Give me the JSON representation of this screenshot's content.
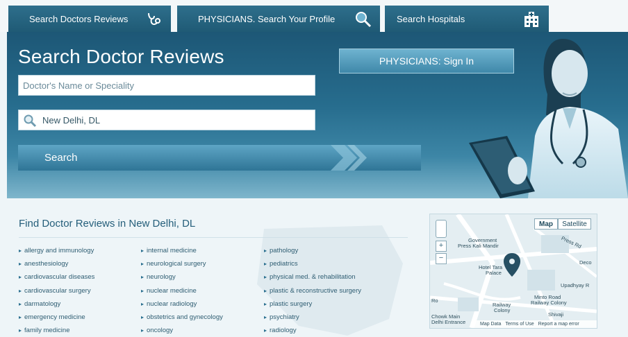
{
  "tabs": [
    {
      "label": "Search Doctors Reviews",
      "icon": "stethoscope-icon"
    },
    {
      "label": "PHYSICIANS. Search Your Profile",
      "icon": "magnifier-icon"
    },
    {
      "label": "Search Hospitals",
      "icon": "hospital-icon"
    }
  ],
  "hero": {
    "title": "Search Doctor Reviews",
    "name_placeholder": "Doctor's Name or Speciality",
    "location_value": "New Delhi, DL",
    "search_label": "Search",
    "signin_label": "PHYSICIANS: Sign In"
  },
  "find": {
    "title": "Find Doctor Reviews in New Delhi, DL",
    "columns": [
      [
        "allergy and immunology",
        "anesthesiology",
        "cardiovascular diseases",
        "cardiovascular surgery",
        "darmatology",
        "emergency medicine",
        "family medicine"
      ],
      [
        "internal medicine",
        "neurological surgery",
        "neurology",
        "nuclear medicine",
        "nuclear radiology",
        "obstetrics and gynecology",
        "oncology"
      ],
      [
        "pathology",
        "pediatrics",
        "physical med. & rehabilitation",
        "plastic & reconstructive surgery",
        "plastic surgery",
        "psychiatry",
        "radiology"
      ]
    ]
  },
  "map": {
    "map_btn": "Map",
    "satellite_btn": "Satellite",
    "labels": {
      "government_press": "Government",
      "press_kali": "Press Kali Mandir",
      "press_rd": "Press Rd",
      "hotel_tara": "Hotel Tara",
      "palace": "Palace",
      "minto": "Minto Road",
      "railway_colony": "Railway Colony",
      "railway": "Railway",
      "colony": "Colony",
      "shivaji": "Shivaji",
      "decor": "Deco",
      "upadhyay": "Upadhyay R",
      "delhi_entrance": "Delhi Entrance",
      "chowk": "Chowk Main",
      "rd": "Ro",
      "map_data": "Map Data",
      "terms": "Terms of Use",
      "report": "Report a map error"
    }
  },
  "colors": {
    "accent": "#2a6f8f",
    "dark": "#1f5a75"
  }
}
